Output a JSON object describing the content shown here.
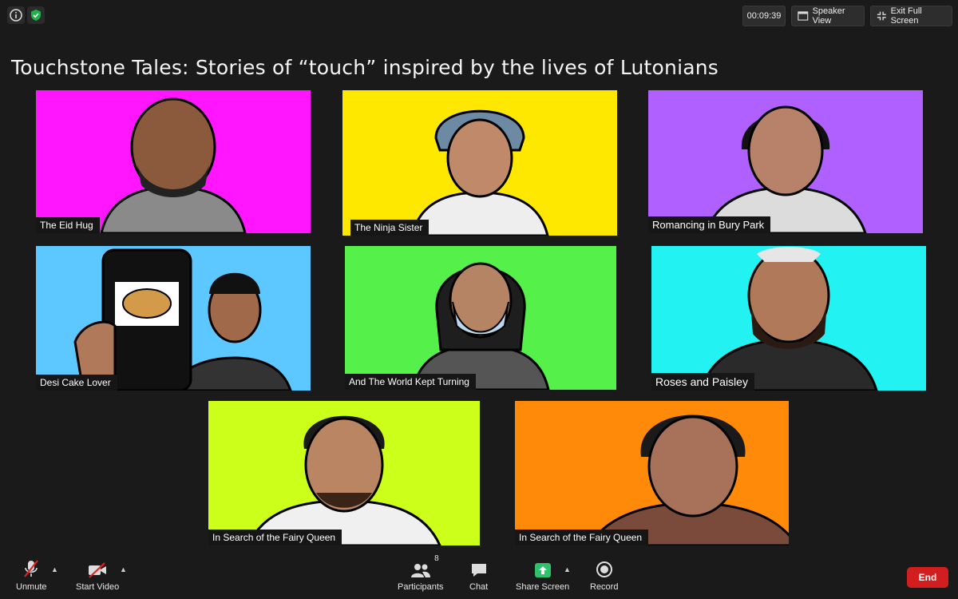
{
  "topbar": {
    "timer": "00:09:39",
    "speaker_view_label": "Speaker View",
    "exit_fullscreen_label": "Exit Full Screen"
  },
  "headline": "Touchstone Tales: Stories of “touch” inspired by the lives of Lutonians",
  "tiles": [
    {
      "name": "The Eid Hug",
      "bg": "#ff16ff"
    },
    {
      "name": "The Ninja Sister",
      "bg": "#ffe800"
    },
    {
      "name": "Romancing in Bury Park",
      "bg": "#b060ff"
    },
    {
      "name": "Desi Cake Lover",
      "bg": "#5cc8ff"
    },
    {
      "name": "And The World Kept Turning",
      "bg": "#55f04a"
    },
    {
      "name": "Roses and Paisley",
      "bg": "#22f2f2"
    },
    {
      "name": "In Search of the Fairy Queen",
      "bg": "#ccff1a"
    },
    {
      "name": "In Search of the Fairy Queen",
      "bg": "#ff8a0a"
    }
  ],
  "toolbar": {
    "unmute_label": "Unmute",
    "start_video_label": "Start Video",
    "participants_label": "Participants",
    "participants_count": "8",
    "chat_label": "Chat",
    "share_screen_label": "Share Screen",
    "record_label": "Record",
    "end_label": "End"
  },
  "colors": {
    "background": "#1a1a1a",
    "share_green": "#2ec26b",
    "end_red": "#d21e1e",
    "shield_green": "#21b14b"
  }
}
